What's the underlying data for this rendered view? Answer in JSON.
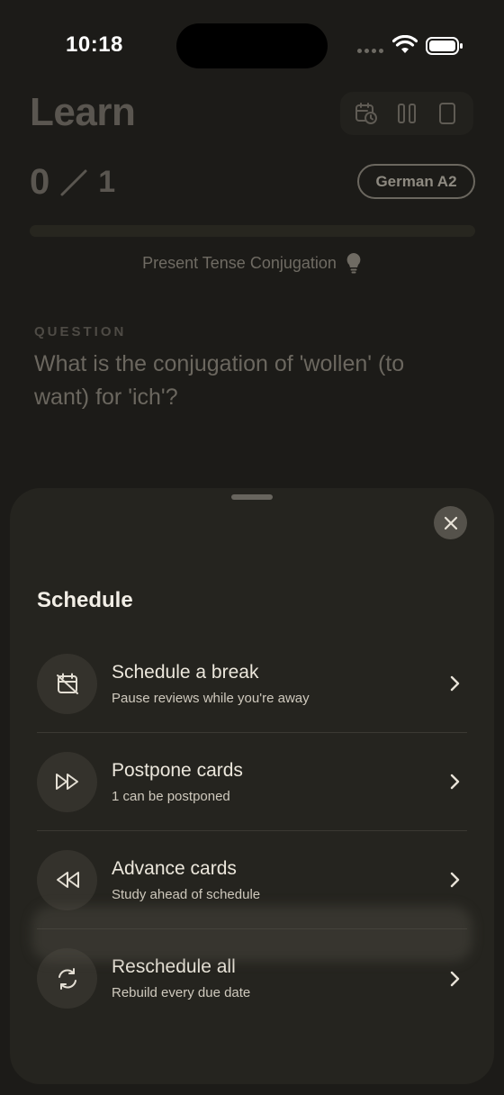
{
  "status_bar": {
    "time": "10:18"
  },
  "header": {
    "title": "Learn",
    "tools": [
      {
        "icon": "calendar-clock-icon"
      },
      {
        "icon": "pause-icon"
      },
      {
        "icon": "phone-icon"
      }
    ]
  },
  "progress": {
    "current": "0",
    "total": "1",
    "fraction": 0.0
  },
  "level": "German A2",
  "topic": "Present Tense Conjugation",
  "question": {
    "label": "QUESTION",
    "text": "What is the conjugation of 'wollen' (to want) for 'ich'?"
  },
  "sheet": {
    "title": "Schedule",
    "options": [
      {
        "title": "Schedule a break",
        "subtitle": "Pause reviews while you're away",
        "icon": "calendar-off-icon"
      },
      {
        "title": "Postpone cards",
        "subtitle": "1 can be postponed",
        "icon": "fast-forward-icon"
      },
      {
        "title": "Advance cards",
        "subtitle": "Study ahead of schedule",
        "icon": "rewind-icon"
      },
      {
        "title": "Reschedule all",
        "subtitle": "Rebuild every due date",
        "icon": "refresh-icon"
      }
    ]
  },
  "colors": {
    "background": "#1c1b18",
    "sheet": "#25241f",
    "text": "#ece7dc"
  }
}
